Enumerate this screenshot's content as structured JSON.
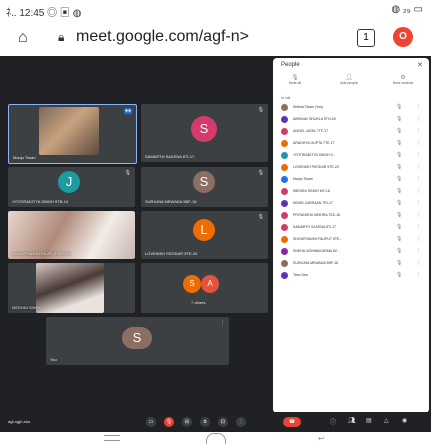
{
  "status_bar": {
    "left": "ﾈ..  12:45  ◎ ▣ ◍",
    "right": "◍ ₂₉ ▭"
  },
  "browser": {
    "url": "meet.google.com/agf-n>",
    "tab_count": "1",
    "opera_icon": "O"
  },
  "tiles": [
    {
      "name": "Manju Tiwari",
      "type": "photo"
    },
    {
      "name": "SAMARTH SAXENA 8TI-17",
      "initial": "S",
      "color": "#d33b6c"
    },
    {
      "name": "JYOTIRADITYA SINGH 9TB-14",
      "initial": "J",
      "color": "#1e9aa3"
    },
    {
      "name": "SURAJNA MEWADA 5BF-16",
      "initial": "S",
      "color": "#8d6e63"
    },
    {
      "name": "SHOURYANSH RAJPUT 5TE-15",
      "type": "photo"
    },
    {
      "name": "LOVENISH PATIDAR 9TE-20",
      "initial": "L",
      "color": "#ef6c00"
    },
    {
      "name": "MEDHNI SINGH",
      "type": "photo"
    },
    {
      "name": "7 others",
      "initials": [
        "S",
        "A"
      ],
      "colors": [
        "#ef6c00",
        "#e6533c"
      ]
    },
    {
      "name": "You",
      "initial": "S",
      "color": "#8d6e63"
    }
  ],
  "people_panel": {
    "title": "People",
    "actions": [
      "Mute all",
      "Add people",
      "Host controls"
    ],
    "section": "In call",
    "participants": [
      {
        "name": "Shikha Tiwari (You)",
        "color": "#8d6e63"
      },
      {
        "name": "ABHINAV SHUKLA 9TH-18",
        "color": "#5e35b1"
      },
      {
        "name": "ANGEL JATAV 7TF-17",
        "color": "#d33b6c"
      },
      {
        "name": "ARADHYA GUPTA 7TE-17",
        "color": "#ef6c00"
      },
      {
        "name": "JYOTIRADITYA SINGH 9...",
        "color": "#1e9aa3"
      },
      {
        "name": "LOVENISH PATIDAR 9TE-20",
        "color": "#ef6c00"
      },
      {
        "name": "Manju Tiwari",
        "color": "#1a73e8"
      },
      {
        "name": "MEDHNI SINGH 6IY-16",
        "color": "#d33b6c"
      },
      {
        "name": "MOHD ZARRAAN 7RI-17",
        "color": "#5e35b1"
      },
      {
        "name": "PRIYANSHU MISHRA 7EZ-16",
        "color": "#d33b6c"
      },
      {
        "name": "SAMARTH SAXENA 8TI-17",
        "color": "#d33b6c"
      },
      {
        "name": "SHOURYANSH RAJPUT 5TE...",
        "color": "#ef6c00"
      },
      {
        "name": "SNEHA VISHWAKARMA 5V...",
        "color": "#8e24aa"
      },
      {
        "name": "SURAJNA MEWADA 5BF-16",
        "color": "#8d6e63"
      },
      {
        "name": "Tanu Sen",
        "color": "#5e35b1"
      }
    ]
  },
  "controls": {
    "meeting_code": "agf-ngjh-shu"
  }
}
